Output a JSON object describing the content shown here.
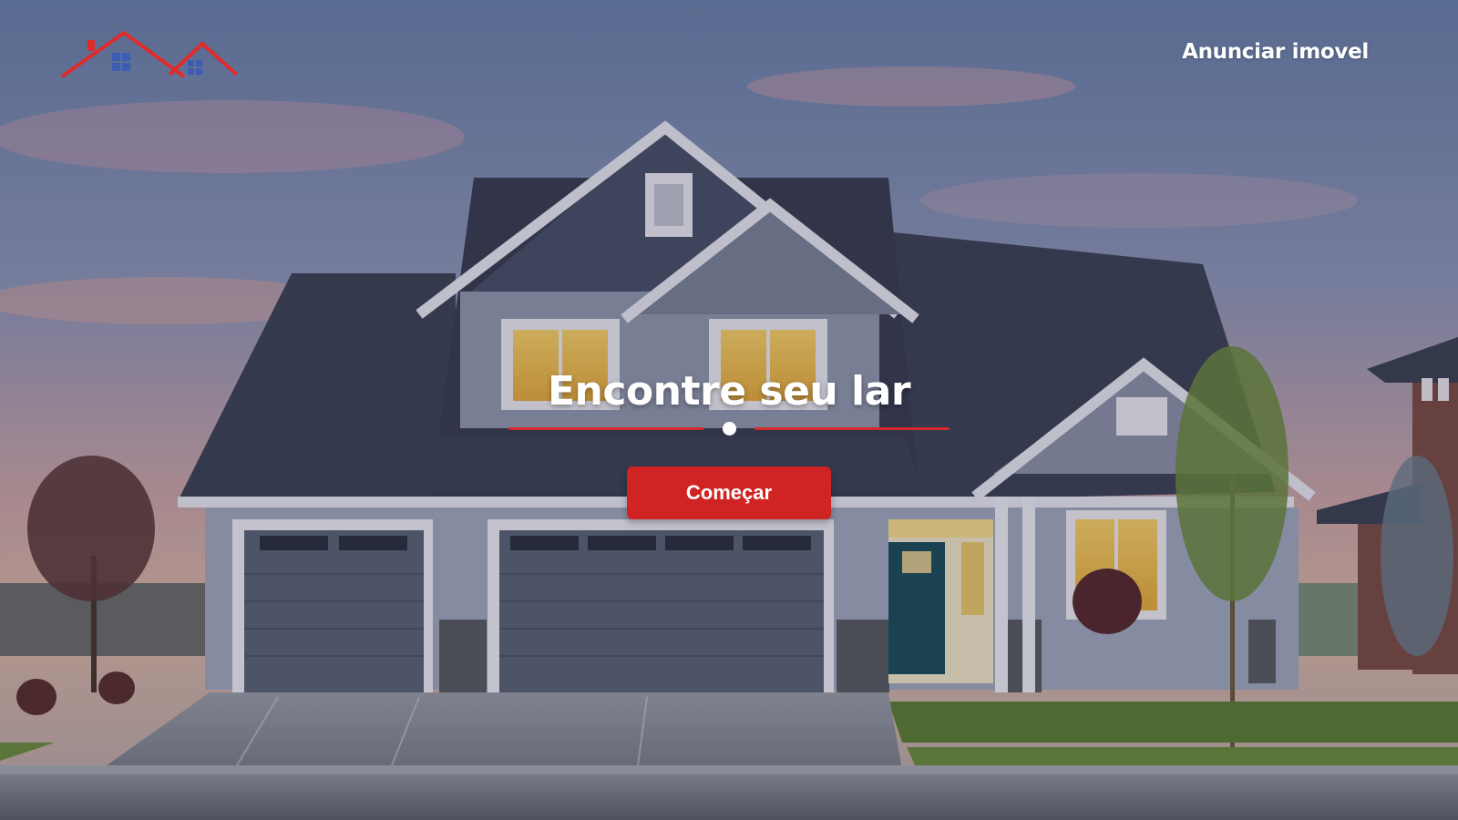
{
  "brand": {
    "logo_icon": "house-roofs-logo",
    "roof_color": "#e02b2b",
    "window_color": "#3b5db5"
  },
  "nav": {
    "advertise_label": "Anunciar imovel"
  },
  "hero": {
    "background_icon": "suburban-house-photo",
    "headline": "Encontre seu lar",
    "cta_label": "Começar",
    "accent_color": "#d02424"
  }
}
